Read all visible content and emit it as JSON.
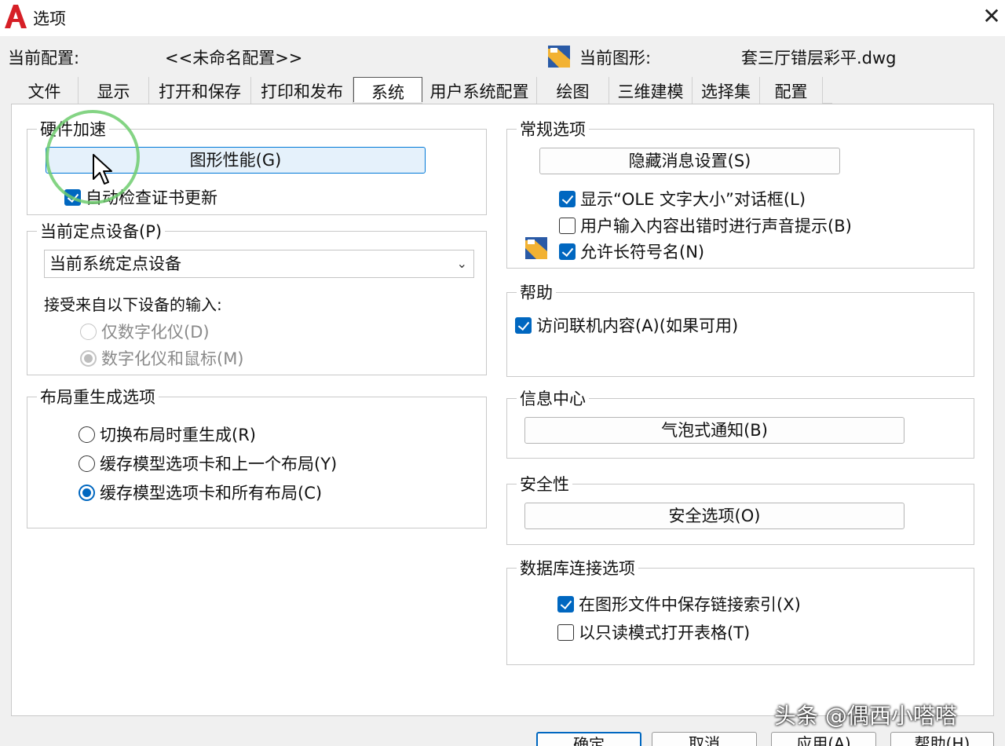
{
  "window": {
    "title": "选项",
    "close_glyph": "✕"
  },
  "profile": {
    "current_profile_label": "当前配置:",
    "current_profile_value": "<<未命名配置>>",
    "current_drawing_label": "当前图形:",
    "current_drawing_value": "套三厅错层彩平.dwg"
  },
  "tabs": [
    {
      "label": "文件"
    },
    {
      "label": "显示"
    },
    {
      "label": "打开和保存"
    },
    {
      "label": "打印和发布"
    },
    {
      "label": "系统",
      "active": true
    },
    {
      "label": "用户系统配置"
    },
    {
      "label": "绘图"
    },
    {
      "label": "三维建模"
    },
    {
      "label": "选择集"
    },
    {
      "label": "配置"
    }
  ],
  "hardware": {
    "title": "硬件加速",
    "graphics_button": "图形性能(G)",
    "auto_check_label": "自动检查证书更新",
    "auto_check_checked": true
  },
  "pointing": {
    "title": "当前定点设备(P)",
    "device_value": "当前系统定点设备",
    "accept_label": "接受来自以下设备的输入:",
    "digitizer_only": "仅数字化仪(D)",
    "digitizer_mouse": "数字化仪和鼠标(M)"
  },
  "layout_regen": {
    "title": "布局重生成选项",
    "options": [
      {
        "label": "切换布局时重生成(R)",
        "selected": false
      },
      {
        "label": "缓存模型选项卡和上一个布局(Y)",
        "selected": false
      },
      {
        "label": "缓存模型选项卡和所有布局(C)",
        "selected": true
      }
    ]
  },
  "general": {
    "title": "常规选项",
    "hidden_messages_button": "隐藏消息设置(S)",
    "show_ole_label": "显示“OLE 文字大小”对话框(L)",
    "show_ole_checked": true,
    "beep_label": "用户输入内容出错时进行声音提示(B)",
    "beep_checked": false,
    "long_names_label": "允许长符号名(N)",
    "long_names_checked": true
  },
  "help": {
    "title": "帮助",
    "online_label": "访问联机内容(A)(如果可用)",
    "online_checked": true
  },
  "infocenter": {
    "title": "信息中心",
    "balloon_button": "气泡式通知(B)"
  },
  "security": {
    "title": "安全性",
    "options_button": "安全选项(O)"
  },
  "database": {
    "title": "数据库连接选项",
    "store_links_label": "在图形文件中保存链接索引(X)",
    "store_links_checked": true,
    "readonly_label": "以只读模式打开表格(T)",
    "readonly_checked": false
  },
  "footer": {
    "ok": "确定",
    "cancel": "取消",
    "apply": "应用(A)",
    "help": "帮助(H)"
  },
  "watermark": "头条 @偶西小嗒嗒",
  "colors": {
    "accent": "#0067c0",
    "logo_red": "#d61f26",
    "highlight_green": "#6ecd6e"
  },
  "icons": {
    "app": "autocad-logo-icon",
    "drawing": "dwg-file-icon",
    "dropdown": "chevron-down-icon",
    "cursor": "mouse-pointer-icon"
  }
}
